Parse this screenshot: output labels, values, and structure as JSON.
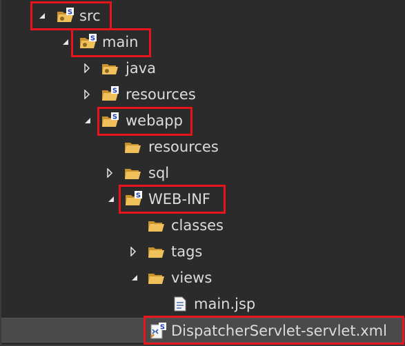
{
  "tree": {
    "items": [
      {
        "label": "src",
        "icon": "source-folder-package-icon",
        "expanded": true
      },
      {
        "label": "main",
        "icon": "source-folder-package-icon",
        "expanded": true
      },
      {
        "label": "java",
        "icon": "package-folder-icon",
        "expanded": false
      },
      {
        "label": "resources",
        "icon": "source-folder-icon",
        "expanded": false
      },
      {
        "label": "webapp",
        "icon": "source-folder-icon",
        "expanded": true
      },
      {
        "label": "resources",
        "icon": "folder-icon"
      },
      {
        "label": "sql",
        "icon": "folder-icon",
        "expanded": false
      },
      {
        "label": "WEB-INF",
        "icon": "source-folder-icon",
        "expanded": true
      },
      {
        "label": "classes",
        "icon": "folder-icon"
      },
      {
        "label": "tags",
        "icon": "folder-icon",
        "expanded": false
      },
      {
        "label": "views",
        "icon": "folder-icon",
        "expanded": true
      },
      {
        "label": "main.jsp",
        "icon": "jsp-file-icon"
      },
      {
        "label": "DispatcherServlet-servlet.xml",
        "icon": "spring-xml-file-icon",
        "selected": true
      }
    ]
  },
  "colors": {
    "background": "#2b2b2b",
    "text": "#dcdcdc",
    "highlight_box": "#e8151c",
    "selection": "#4a4a4a",
    "folder": "#e9b54d",
    "spring_badge": "#1d3fbb"
  }
}
